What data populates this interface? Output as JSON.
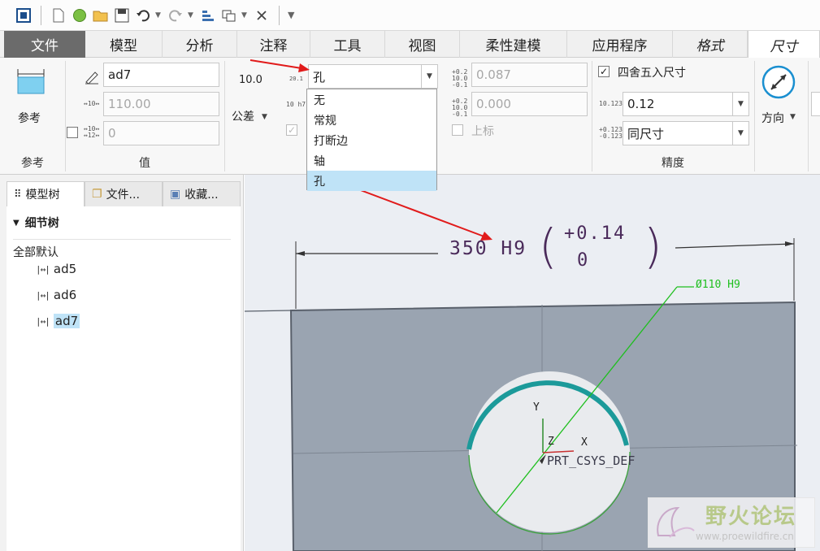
{
  "quick_access": {
    "icons": [
      "app-icon",
      "new-icon",
      "globe-icon",
      "open-icon",
      "save-icon",
      "undo-icon",
      "redo-icon",
      "regenerate-icon",
      "windows-icon",
      "close-window-icon",
      "customize-icon"
    ]
  },
  "tabs": [
    {
      "label": "文件"
    },
    {
      "label": "模型"
    },
    {
      "label": "分析"
    },
    {
      "label": "注释"
    },
    {
      "label": "工具"
    },
    {
      "label": "视图"
    },
    {
      "label": "柔性建模"
    },
    {
      "label": "应用程序"
    },
    {
      "label": "格式"
    },
    {
      "label": "尺寸"
    }
  ],
  "ribbon": {
    "reference": {
      "button_label": "参考",
      "group_label": "参考"
    },
    "value": {
      "name_field": "ad7",
      "nominal_value": "110.00",
      "override_value": "0",
      "group_label": "值"
    },
    "tolerance": {
      "display_icon_text": "10.0",
      "button_label": "公差",
      "fit_small_1": "20.1",
      "fit_small_2": "10 h7"
    },
    "fit_combo": {
      "value": "孔"
    },
    "upper_tol": "0.087",
    "lower_tol": "0.000",
    "superscript_label": "上标",
    "precision": {
      "round_label": "四舍五入尺寸",
      "round_checked": true,
      "decimals_value": "0.12",
      "tol_decimals_value": "同尺寸",
      "group_label": "精度"
    },
    "direction": {
      "button_label": "方向"
    }
  },
  "fit_dropdown": {
    "options": [
      "无",
      "常规",
      "打断边",
      "轴",
      "孔"
    ],
    "selected_index": 4
  },
  "left_panel": {
    "tabs": [
      "模型树",
      "文件...",
      "收藏..."
    ],
    "tree_header": "细节树",
    "tree_subheader": "全部默认",
    "items": [
      "ad5",
      "ad6",
      "ad7"
    ],
    "selected_item": "ad7"
  },
  "drawing": {
    "dimension_text": "350 H9",
    "tol_upper": "+0.14",
    "tol_lower": "0",
    "hole_note": "Ø110 H9",
    "axis_y": "Y",
    "axis_z": "Z",
    "axis_x": "X",
    "csys_label": "PRT_CSYS_DEF"
  },
  "watermark": {
    "title": "野火论坛",
    "url": "www.proewildfire.cn"
  },
  "colors": {
    "plate": "#9aa4b1",
    "hole_arc": "#1c9a9a",
    "leader": "#1fbf1f",
    "dimension": "#4a2a5a",
    "annotation_arrow": "#e11b1b"
  }
}
